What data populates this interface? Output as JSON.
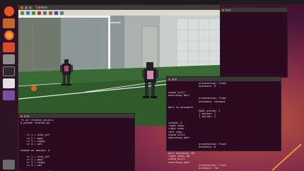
{
  "top_window": {
    "title": "Camera",
    "toolbar_icons": [
      "open-icon",
      "save-icon",
      "play-icon",
      "record-icon",
      "zoom-icon",
      "settings-icon",
      "snapshot-icon",
      "help-icon"
    ]
  },
  "launcher": {
    "icons": [
      "ubuntu-icon",
      "files-icon",
      "firefox-icon",
      "software-icon",
      "settings-icon",
      "terminal-icon",
      "text-editor-icon",
      "workspace-icon"
    ]
  },
  "terminal_left": {
    "title": "",
    "lines": [
      "~$ cd ~/catkin_ws/src/",
      "$ python referee.py",
      "",
      "  ",
      "",
      "    >> 1 = kick_off",
      "    >> 2 = goal",
      "    >> 3 = ready",
      "    >> 4 = set",
      "",
      "choose an option: 4",
      "",
      "    >> 1 = kick_off",
      "    >> 2 = goal",
      "    >> 3 = ready",
      "    >> 4 = set",
      "",
      "choose an option: []"
    ]
  },
  "terminal_right": {
    "title": "",
    "lines": [
      "                    orientation: front",
      "                    distance: 0",
      "",
      "stand still",
      "searching ball",
      "                    orientation: front",
      "                    distance: forward",
      "",
      "ball is missable",
      "                    GOAL action: 1",
      "                    [ action: ]",
      "                    [ action: ]",
      "",
      "rotate: 1",
      "right step",
      "right step",
      "left step",
      "stand still",
      "searching ball",
      "",
      "                    orientation: front",
      "                    distance: 0",
      "",
      "ball distance: 80",
      "right step: 80",
      "stand still",
      "searching goal",
      "                    orientation: front",
      "                    distance: far"
    ]
  },
  "colors": {
    "terminal_bg": "#2c0a22",
    "window_chrome": "#3c3b37",
    "accent": "#e95420",
    "field": "#2f5a2a",
    "robot_pink": "#c0407a"
  }
}
